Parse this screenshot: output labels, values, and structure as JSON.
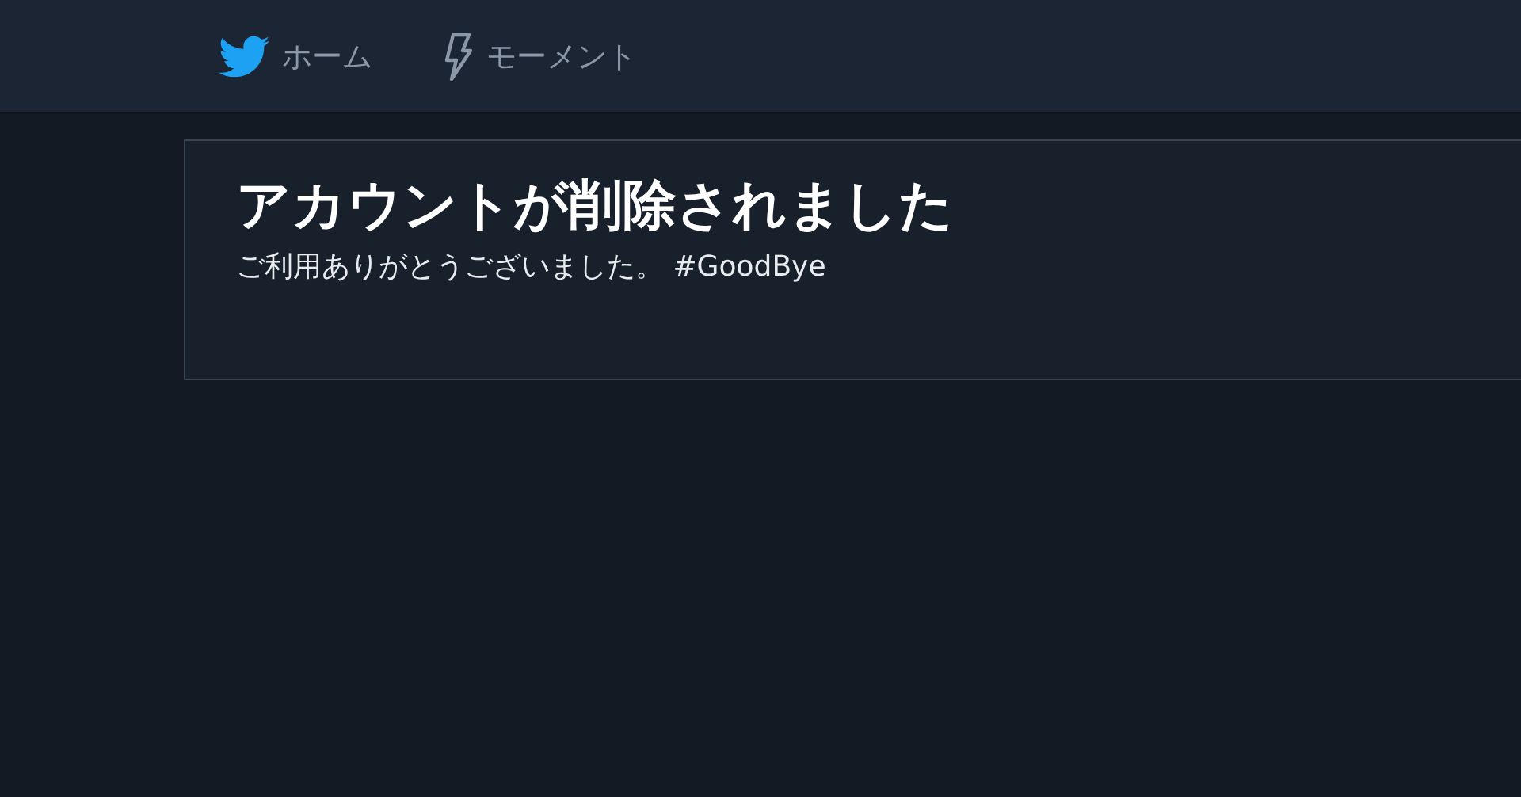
{
  "nav": {
    "items": [
      {
        "kind": "bird",
        "label": "ホーム"
      },
      {
        "kind": "bolt",
        "label": "モーメント"
      }
    ]
  },
  "notice": {
    "title": "アカウントが削除されました",
    "message": "ご利用ありがとうございました。 #GoodBye"
  }
}
